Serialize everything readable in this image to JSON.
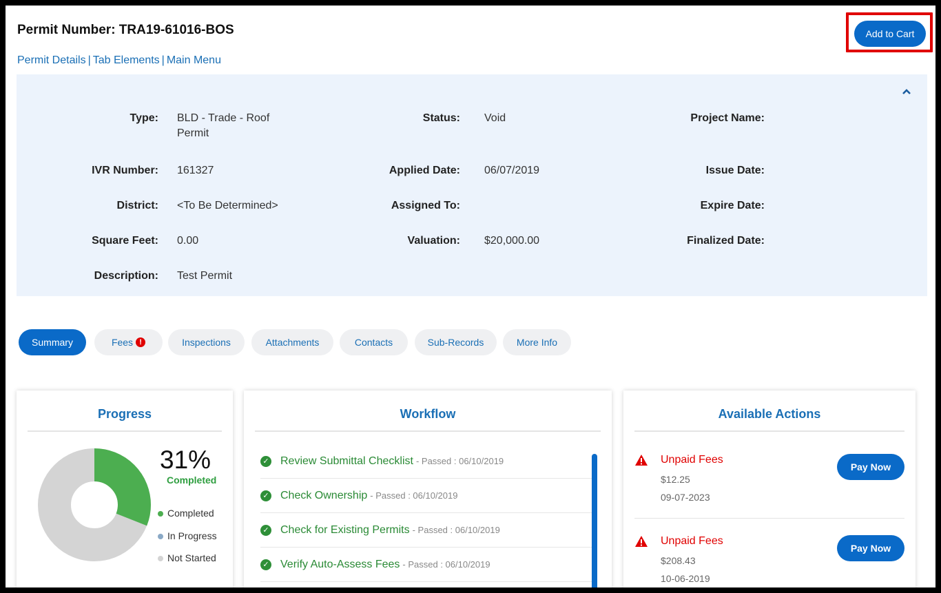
{
  "header": {
    "title": "Permit Number: TRA19-61016-BOS",
    "add_to_cart_label": "Add to Cart"
  },
  "nav": {
    "links": [
      "Permit Details",
      "Tab Elements",
      "Main Menu"
    ],
    "separator": "|"
  },
  "info": {
    "collapse_icon": "chevron-up-icon",
    "fields": {
      "type_label": "Type:",
      "type_value_line1": "BLD - Trade - Roof",
      "type_value_line2": "Permit",
      "status_label": "Status:",
      "status_value": "Void",
      "project_name_label": "Project Name:",
      "ivr_label": "IVR Number:",
      "ivr_value": "161327",
      "applied_label": "Applied Date:",
      "applied_value": "06/07/2019",
      "issue_label": "Issue Date:",
      "district_label": "District:",
      "district_value": "<To Be Determined>",
      "assigned_label": "Assigned To:",
      "expire_label": "Expire Date:",
      "sqft_label": "Square Feet:",
      "sqft_value": "0.00",
      "valuation_label": "Valuation:",
      "valuation_value": "$20,000.00",
      "finalized_label": "Finalized Date:",
      "description_label": "Description:",
      "description_value": "Test Permit"
    }
  },
  "tabs": [
    {
      "label": "Summary",
      "active": true
    },
    {
      "label": "Fees",
      "alert": "!"
    },
    {
      "label": "Inspections"
    },
    {
      "label": "Attachments"
    },
    {
      "label": "Contacts"
    },
    {
      "label": "Sub-Records"
    },
    {
      "label": "More Info"
    }
  ],
  "progress": {
    "title": "Progress",
    "percent_text": "31%",
    "percent_caption": "Completed",
    "completed_fraction": 0.31,
    "legend": [
      "Completed",
      "In Progress",
      "Not Started"
    ],
    "colors": {
      "completed": "#4cae50",
      "in_progress": "#8aa9c6",
      "not_started": "#d4d4d4"
    }
  },
  "workflow": {
    "title": "Workflow",
    "items": [
      {
        "name": "Review Submittal Checklist",
        "meta": "- Passed : 06/10/2019"
      },
      {
        "name": "Check Ownership",
        "meta": "- Passed : 06/10/2019"
      },
      {
        "name": "Check for Existing Permits",
        "meta": "- Passed : 06/10/2019"
      },
      {
        "name": "Verify Auto-Assess Fees",
        "meta": "- Passed : 06/10/2019"
      }
    ],
    "check_icon": "check-circle-icon"
  },
  "actions": {
    "title": "Available Actions",
    "items": [
      {
        "title": "Unpaid Fees",
        "amount": "$12.25",
        "date": "09-07-2023",
        "button": "Pay Now"
      },
      {
        "title": "Unpaid Fees",
        "amount": "$208.43",
        "date": "10-06-2019",
        "button": "Pay Now"
      }
    ],
    "warning_icon": "warning-triangle-icon"
  }
}
